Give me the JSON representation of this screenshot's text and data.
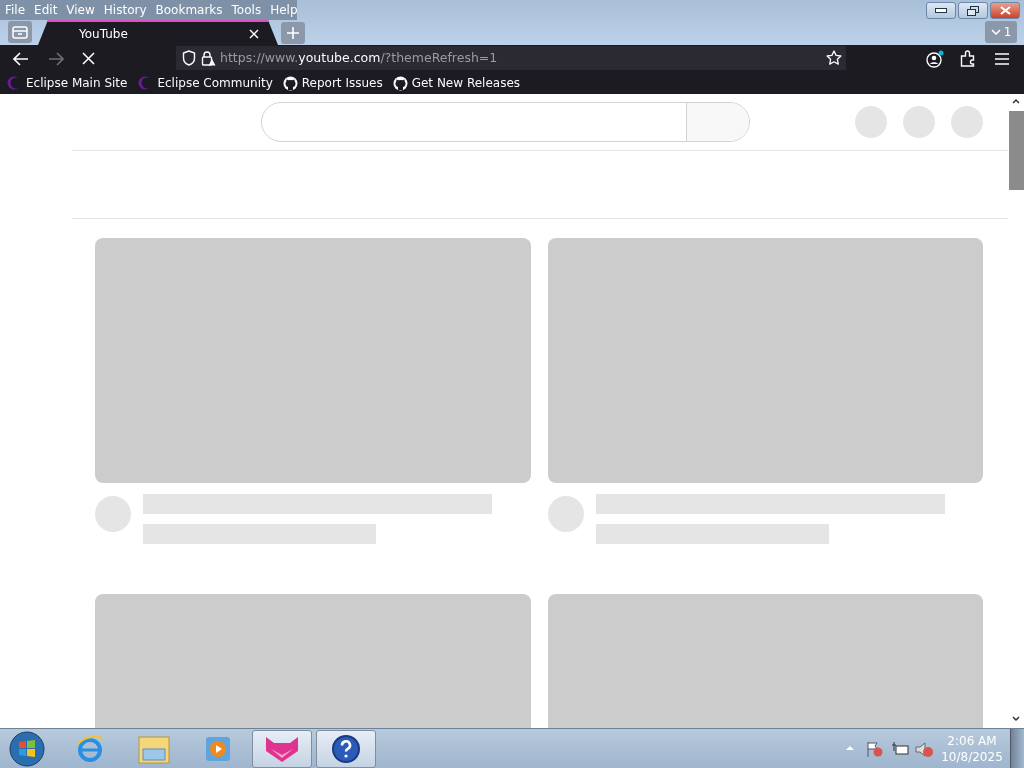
{
  "menu": [
    "File",
    "Edit",
    "View",
    "History",
    "Bookmarks",
    "Tools",
    "Help"
  ],
  "tabs": [
    {
      "label": "YouTube",
      "selected": true,
      "loading": true
    }
  ],
  "tab_count": "1",
  "address": {
    "prefix": "https://www.",
    "domain": "youtube.com",
    "suffix": "/?themeRefresh=1"
  },
  "bookmarks": [
    {
      "label": "Eclipse Main Site",
      "kind": "eclipse"
    },
    {
      "label": "Eclipse Community",
      "kind": "eclipse"
    },
    {
      "label": "Report Issues",
      "kind": "github"
    },
    {
      "label": "Get New Releases",
      "kind": "github"
    }
  ],
  "taskbar": [
    {
      "kind": "ie",
      "open": false
    },
    {
      "kind": "folder",
      "open": false
    },
    {
      "kind": "media",
      "open": false
    },
    {
      "kind": "browser",
      "open": true
    },
    {
      "kind": "help",
      "open": true
    }
  ],
  "clock": {
    "time": "2:06 AM",
    "date": "10/8/2025"
  }
}
